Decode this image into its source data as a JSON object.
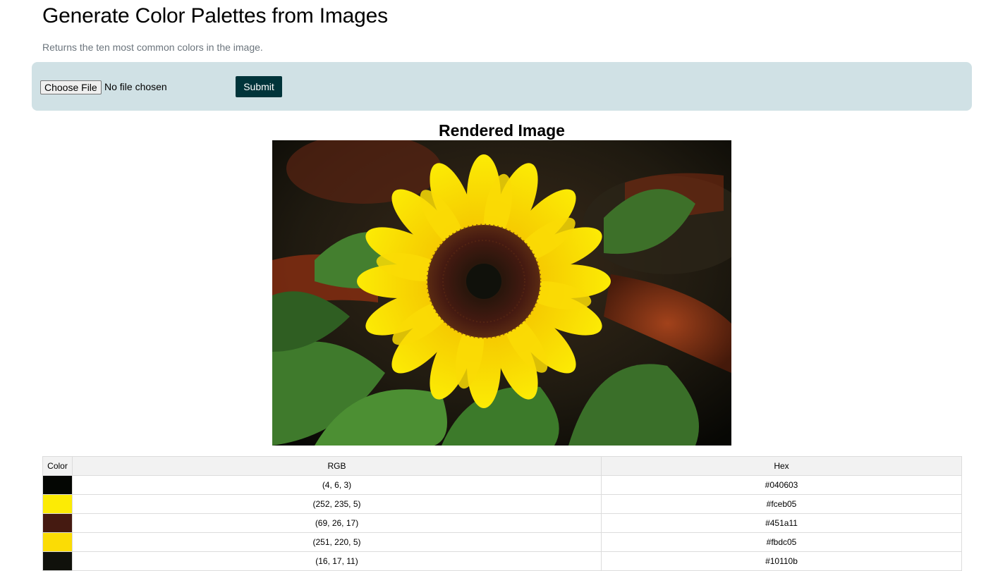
{
  "header": {
    "title": "Generate Color Palettes from Images",
    "subtitle": "Returns the ten most common colors in the image."
  },
  "upload": {
    "choose_file_label": "Choose File",
    "file_status": "No file chosen",
    "submit_label": "Submit"
  },
  "rendered": {
    "title": "Rendered Image"
  },
  "table": {
    "headers": [
      "Color",
      "RGB",
      "Hex"
    ],
    "rows": [
      {
        "rgb": "(4, 6, 3)",
        "hex": "#040603"
      },
      {
        "rgb": "(252, 235, 5)",
        "hex": "#fceb05"
      },
      {
        "rgb": "(69, 26, 17)",
        "hex": "#451a11"
      },
      {
        "rgb": "(251, 220, 5)",
        "hex": "#fbdc05"
      },
      {
        "rgb": "(16, 17, 11)",
        "hex": "#10110b"
      }
    ]
  },
  "colors": {
    "upload_bar_bg": "#d0e1e5",
    "submit_bg": "#00343a"
  }
}
